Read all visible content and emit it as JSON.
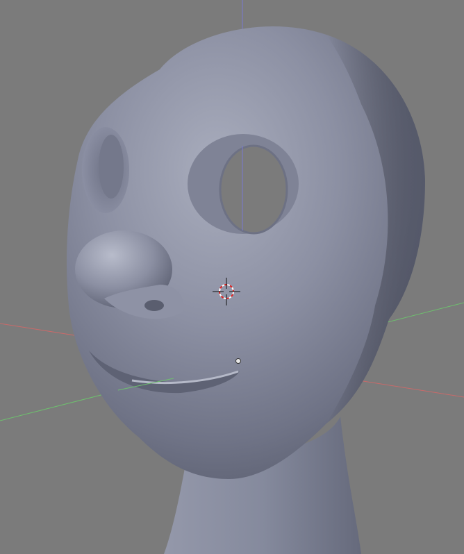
{
  "viewport": {
    "type": "3d-view",
    "background_color": "#7b7b7b",
    "mesh_color": "#8c90a3",
    "axis_colors": {
      "x_axis": "#c96a6a",
      "y_axis": "#6ec06e",
      "z_axis": "#7a7ad0"
    },
    "cursor_icon": "3d-cursor-icon",
    "origin_icon": "object-origin-icon"
  }
}
